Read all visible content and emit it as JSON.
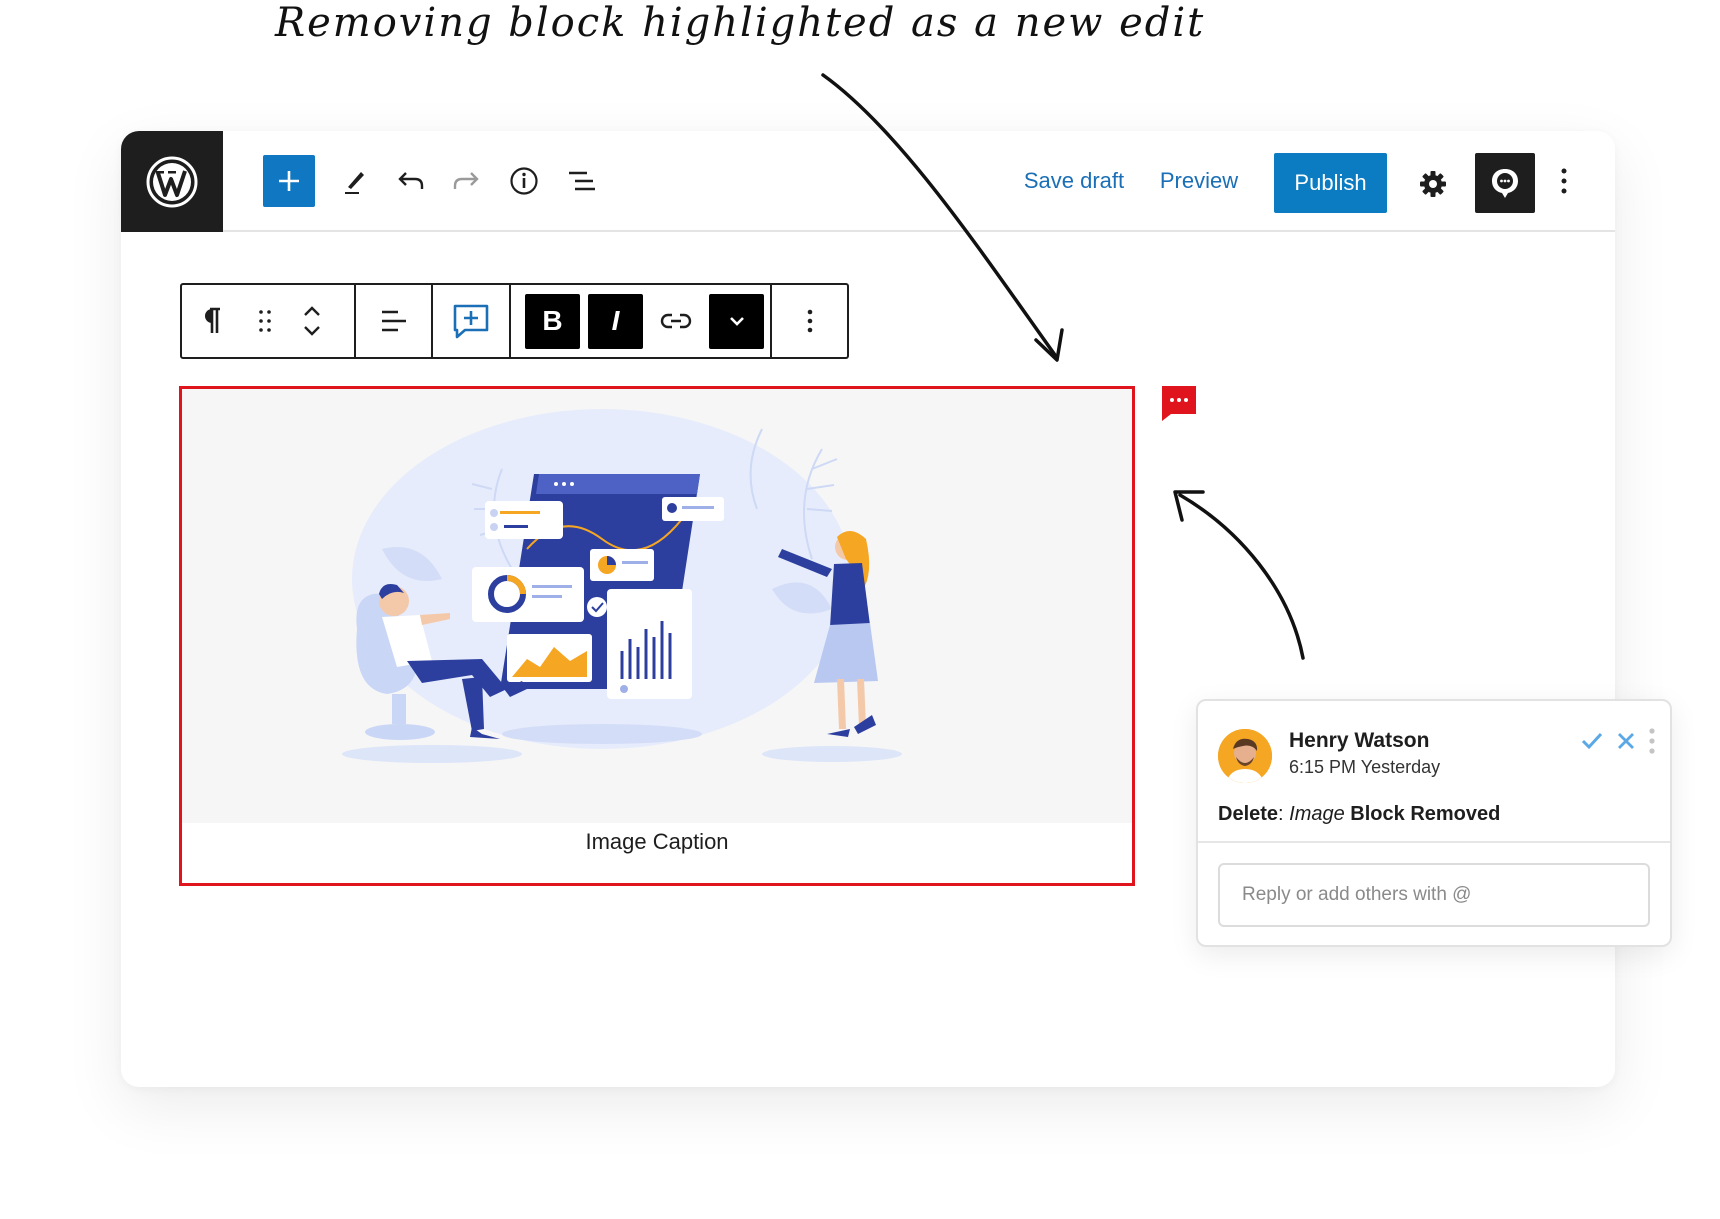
{
  "annotation": {
    "headline": "Removing block highlighted as a new edit"
  },
  "toolbar": {
    "save_draft": "Save draft",
    "preview": "Preview",
    "publish": "Publish"
  },
  "block_toolbar": {
    "bold": "B",
    "italic": "I"
  },
  "image_block": {
    "caption": "Image Caption",
    "highlight_color": "#e0141c"
  },
  "comment": {
    "author": "Henry Watson",
    "time": "6:15 PM Yesterday",
    "action_label": "Delete",
    "separator": ": ",
    "block_type": "Image",
    "status": " Block Removed",
    "reply_placeholder": "Reply or add others with @"
  },
  "colors": {
    "accent": "#0b7cc1",
    "link": "#1a6fb6",
    "alert": "#e0141c"
  }
}
